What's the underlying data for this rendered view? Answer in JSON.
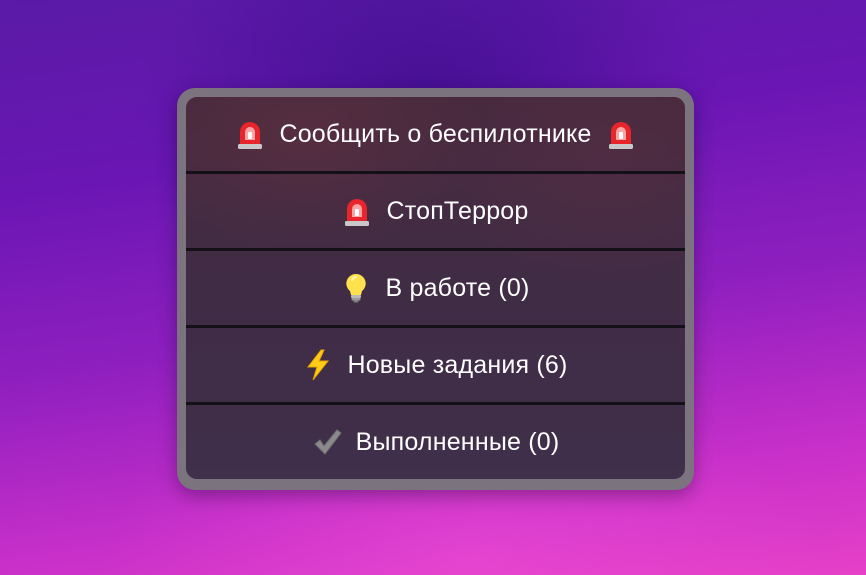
{
  "keyboard": {
    "buttons": [
      {
        "label": "Сообщить о беспилотнике",
        "icon_left": "rotating-light-icon",
        "icon_right": "rotating-light-icon"
      },
      {
        "label": "СтопТеррор",
        "icon_left": "rotating-light-icon"
      },
      {
        "label": "В работе (0)",
        "icon_left": "light-bulb-icon"
      },
      {
        "label": "Новые задания (6)",
        "icon_left": "lightning-icon"
      },
      {
        "label": "Выполненные (0)",
        "icon_left": "check-mark-icon"
      }
    ]
  }
}
